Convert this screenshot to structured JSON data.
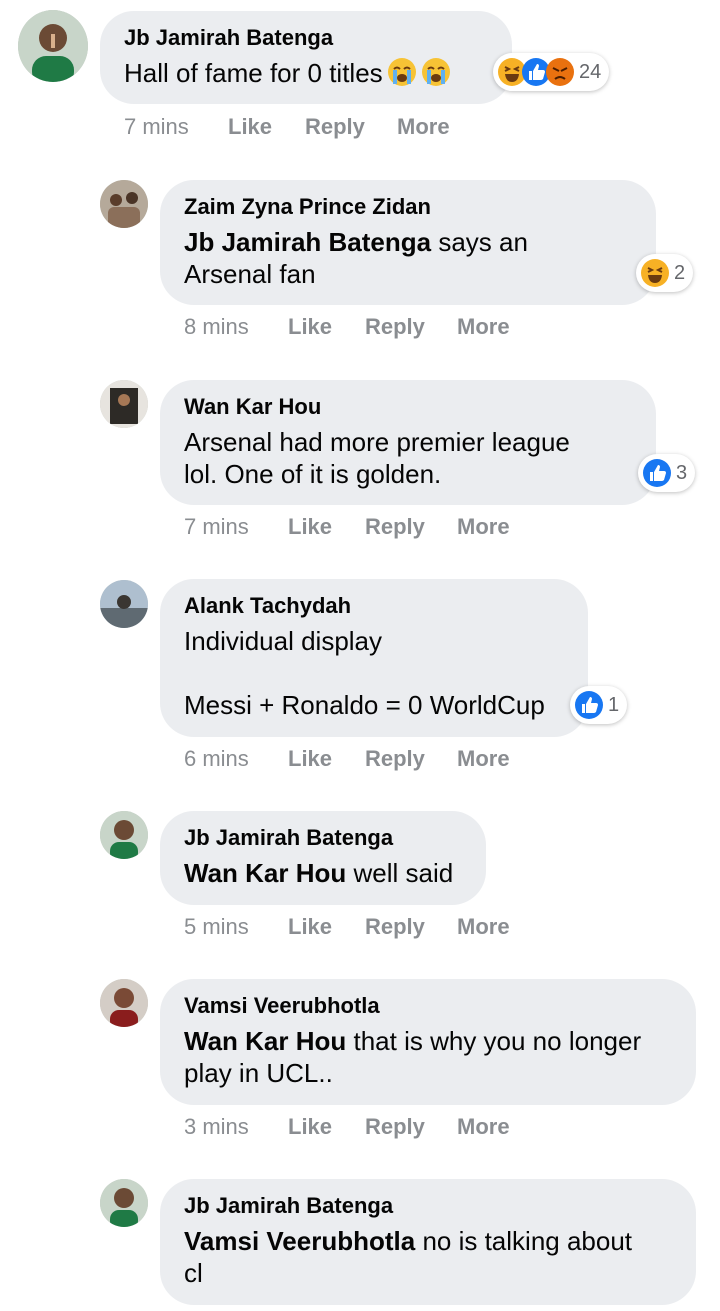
{
  "comments": [
    {
      "author": "Jb Jamirah Batenga",
      "mention": "",
      "text": "Hall of fame for 0 titles",
      "inline_emojis": [
        "crying-face",
        "crying-face"
      ],
      "reactions": [
        "haha",
        "like",
        "angry"
      ],
      "reaction_count": "24",
      "time": "7 mins",
      "actions": [
        "Like",
        "Reply",
        "More"
      ]
    },
    {
      "author": "Zaim Zyna Prince Zidan",
      "mention": "Jb Jamirah Batenga",
      "text": " says an\nArsenal fan",
      "reactions": [
        "haha"
      ],
      "reaction_count": "2",
      "time": "8 mins",
      "actions": [
        "Like",
        "Reply",
        "More"
      ]
    },
    {
      "author": "Wan Kar Hou",
      "mention": "",
      "text": "Arsenal had more premier league\nlol. One of it is golden.",
      "reactions": [
        "like"
      ],
      "reaction_count": "3",
      "time": "7 mins",
      "actions": [
        "Like",
        "Reply",
        "More"
      ]
    },
    {
      "author": "Alank Tachydah",
      "mention": "",
      "text": "Individual display\n\nMessi + Ronaldo = 0 WorldCup",
      "reactions": [
        "like"
      ],
      "reaction_count": "1",
      "time": "6 mins",
      "actions": [
        "Like",
        "Reply",
        "More"
      ]
    },
    {
      "author": "Jb Jamirah Batenga",
      "mention": "Wan Kar Hou",
      "text": " well said",
      "reactions": [],
      "reaction_count": "",
      "time": "5 mins",
      "actions": [
        "Like",
        "Reply",
        "More"
      ]
    },
    {
      "author": "Vamsi Veerubhotla",
      "mention": "Wan Kar Hou",
      "text": " that is why you no longer\nplay in UCL..",
      "reactions": [],
      "reaction_count": "",
      "time": "3 mins",
      "actions": [
        "Like",
        "Reply",
        "More"
      ]
    },
    {
      "author": "Jb Jamirah Batenga",
      "mention": "Vamsi Veerubhotla",
      "text": " no is talking about\ncl",
      "reactions": [],
      "reaction_count": "",
      "time": "",
      "actions": []
    }
  ],
  "colors": {
    "bubble": "#ebedf0",
    "like_blue": "#1877f2",
    "haha_yellow": "#f7b125",
    "angry_orange": "#e9710f",
    "meta_gray": "#8a8d91"
  }
}
